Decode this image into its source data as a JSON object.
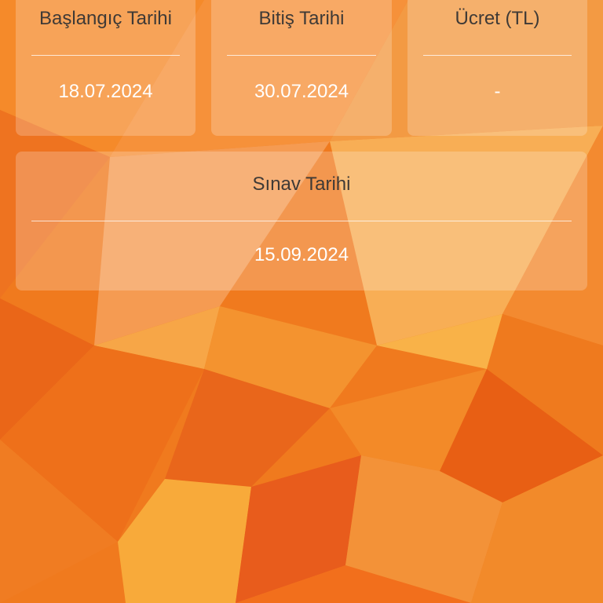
{
  "colors": {
    "background_primary": "#f07a1e",
    "background_light": "#f9a93d",
    "background_dark": "#e65c14",
    "label_text": "#3f3a36",
    "value_text": "#ffffff"
  },
  "cards": {
    "start_date": {
      "label": "Başlangıç Tarihi",
      "value": "18.07.2024"
    },
    "end_date": {
      "label": "Bitiş Tarihi",
      "value": "30.07.2024"
    },
    "fee": {
      "label": "Ücret (TL)",
      "value": "-"
    },
    "exam_date": {
      "label": "Sınav Tarihi",
      "value": "15.09.2024"
    }
  }
}
